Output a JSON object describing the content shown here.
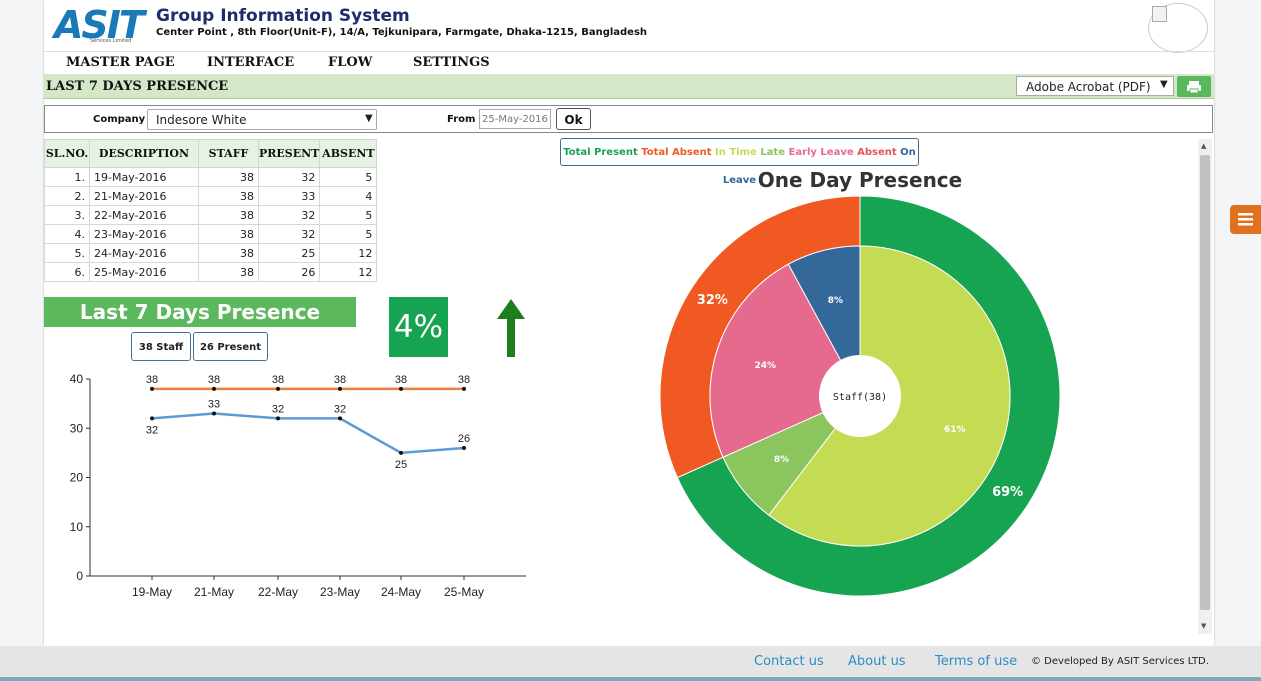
{
  "header": {
    "logo_text": "ASIT",
    "logo_subtext": "Services Limited",
    "title": "Group Information System",
    "address": "Center Point , 8th Floor(Unit-F), 14/A, Tejkunipara, Farmgate, Dhaka-1215, Bangladesh"
  },
  "nav": {
    "items": [
      "MASTER PAGE",
      "INTERFACE",
      "FLOW",
      "SETTINGS"
    ]
  },
  "section": {
    "title": "LAST 7 DAYS PRESENCE",
    "export_selected": "Adobe Acrobat (PDF)"
  },
  "filters": {
    "company_label": "Company",
    "company_value": "Indesore White",
    "from_label": "From",
    "from_value": "25-May-2016",
    "ok_label": "Ok"
  },
  "table": {
    "headers": [
      "SL.NO.",
      "DESCRIPTION",
      "STAFF",
      "PRESENT",
      "ABSENT"
    ],
    "rows": [
      [
        "1.",
        "19-May-2016",
        "38",
        "32",
        "5"
      ],
      [
        "2.",
        "21-May-2016",
        "38",
        "33",
        "4"
      ],
      [
        "3.",
        "22-May-2016",
        "38",
        "32",
        "5"
      ],
      [
        "4.",
        "23-May-2016",
        "38",
        "32",
        "5"
      ],
      [
        "5.",
        "24-May-2016",
        "38",
        "25",
        "12"
      ],
      [
        "6.",
        "25-May-2016",
        "38",
        "26",
        "12"
      ]
    ]
  },
  "summary": {
    "heading": "Last 7 Days Presence",
    "staff_pill": "38 Staff",
    "present_pill": "26 Present",
    "percent": "4%",
    "trend_color": "#1e7e1e"
  },
  "chart_data": [
    {
      "type": "line",
      "x": [
        "19-May",
        "21-May",
        "22-May",
        "23-May",
        "24-May",
        "25-May"
      ],
      "ylim": [
        0,
        40
      ],
      "yticks": [
        0,
        10,
        20,
        30,
        40
      ],
      "series": [
        {
          "values": [
            38,
            38,
            38,
            38,
            38,
            38
          ],
          "color": "#e8823e"
        },
        {
          "values": [
            32,
            33,
            32,
            32,
            25,
            26
          ],
          "color": "#5b9bd5"
        }
      ]
    },
    {
      "type": "pie",
      "title": "One Day Presence",
      "center_label": "Staff(38)",
      "legend": [
        {
          "label": "Total Present",
          "color": "#17a452"
        },
        {
          "label": "Total Absent",
          "color": "#f05a22"
        },
        {
          "label": "In Time",
          "color": "#c4db54"
        },
        {
          "label": "Late",
          "color": "#8ac55e"
        },
        {
          "label": "Early Leave",
          "color": "#e56a8e"
        },
        {
          "label": "Absent",
          "color": "#e05858"
        },
        {
          "label": "On Leave",
          "color": "#34679a"
        }
      ],
      "outer": [
        {
          "name": "Total Present",
          "value": 69,
          "label": "69%",
          "color": "#17a452"
        },
        {
          "name": "Total Absent",
          "value": 32,
          "label": "32%",
          "color": "#f05a22"
        }
      ],
      "inner": [
        {
          "name": "In Time",
          "value": 61,
          "label": "61%",
          "color": "#c4db54"
        },
        {
          "name": "Late",
          "value": 8,
          "label": "8%",
          "color": "#8ac55e"
        },
        {
          "name": "Early Leave",
          "value": 24,
          "label": "24%",
          "color": "#e56a8e"
        },
        {
          "name": "On Leave",
          "value": 8,
          "label": "8%",
          "color": "#34679a"
        }
      ]
    }
  ],
  "footer": {
    "contact": "Contact us",
    "about": "About us",
    "terms": "Terms of use",
    "copyright": "© Developed By ASIT Services LTD."
  }
}
